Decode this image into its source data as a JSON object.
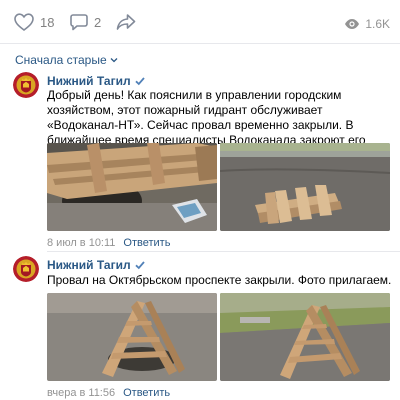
{
  "actions": {
    "likes": "18",
    "comments": "2",
    "views": "1.6K"
  },
  "sort": {
    "label": "Сначала старые"
  },
  "comments": [
    {
      "author": "Нижний Тагил",
      "text": "Добрый день! Как пояснили в управлении городским хозяйством, этот пожарный гидрант обслуживает «Водоканал-НТ». Сейчас провал временно закрыли. В ближайшее время специалисты Водоканала закроют его крышкой и заасфальтируют.",
      "time": "8 июл в 10:11",
      "reply": "Ответить"
    },
    {
      "author": "Нижний Тагил",
      "text": "Провал на Октябрьском проспекте закрыли. Фото прилагаем.",
      "time": "вчера в 11:56",
      "reply": "Ответить"
    }
  ],
  "colors": {
    "link": "#2a5885",
    "muted": "#939393",
    "divider": "#e7e8ec"
  }
}
